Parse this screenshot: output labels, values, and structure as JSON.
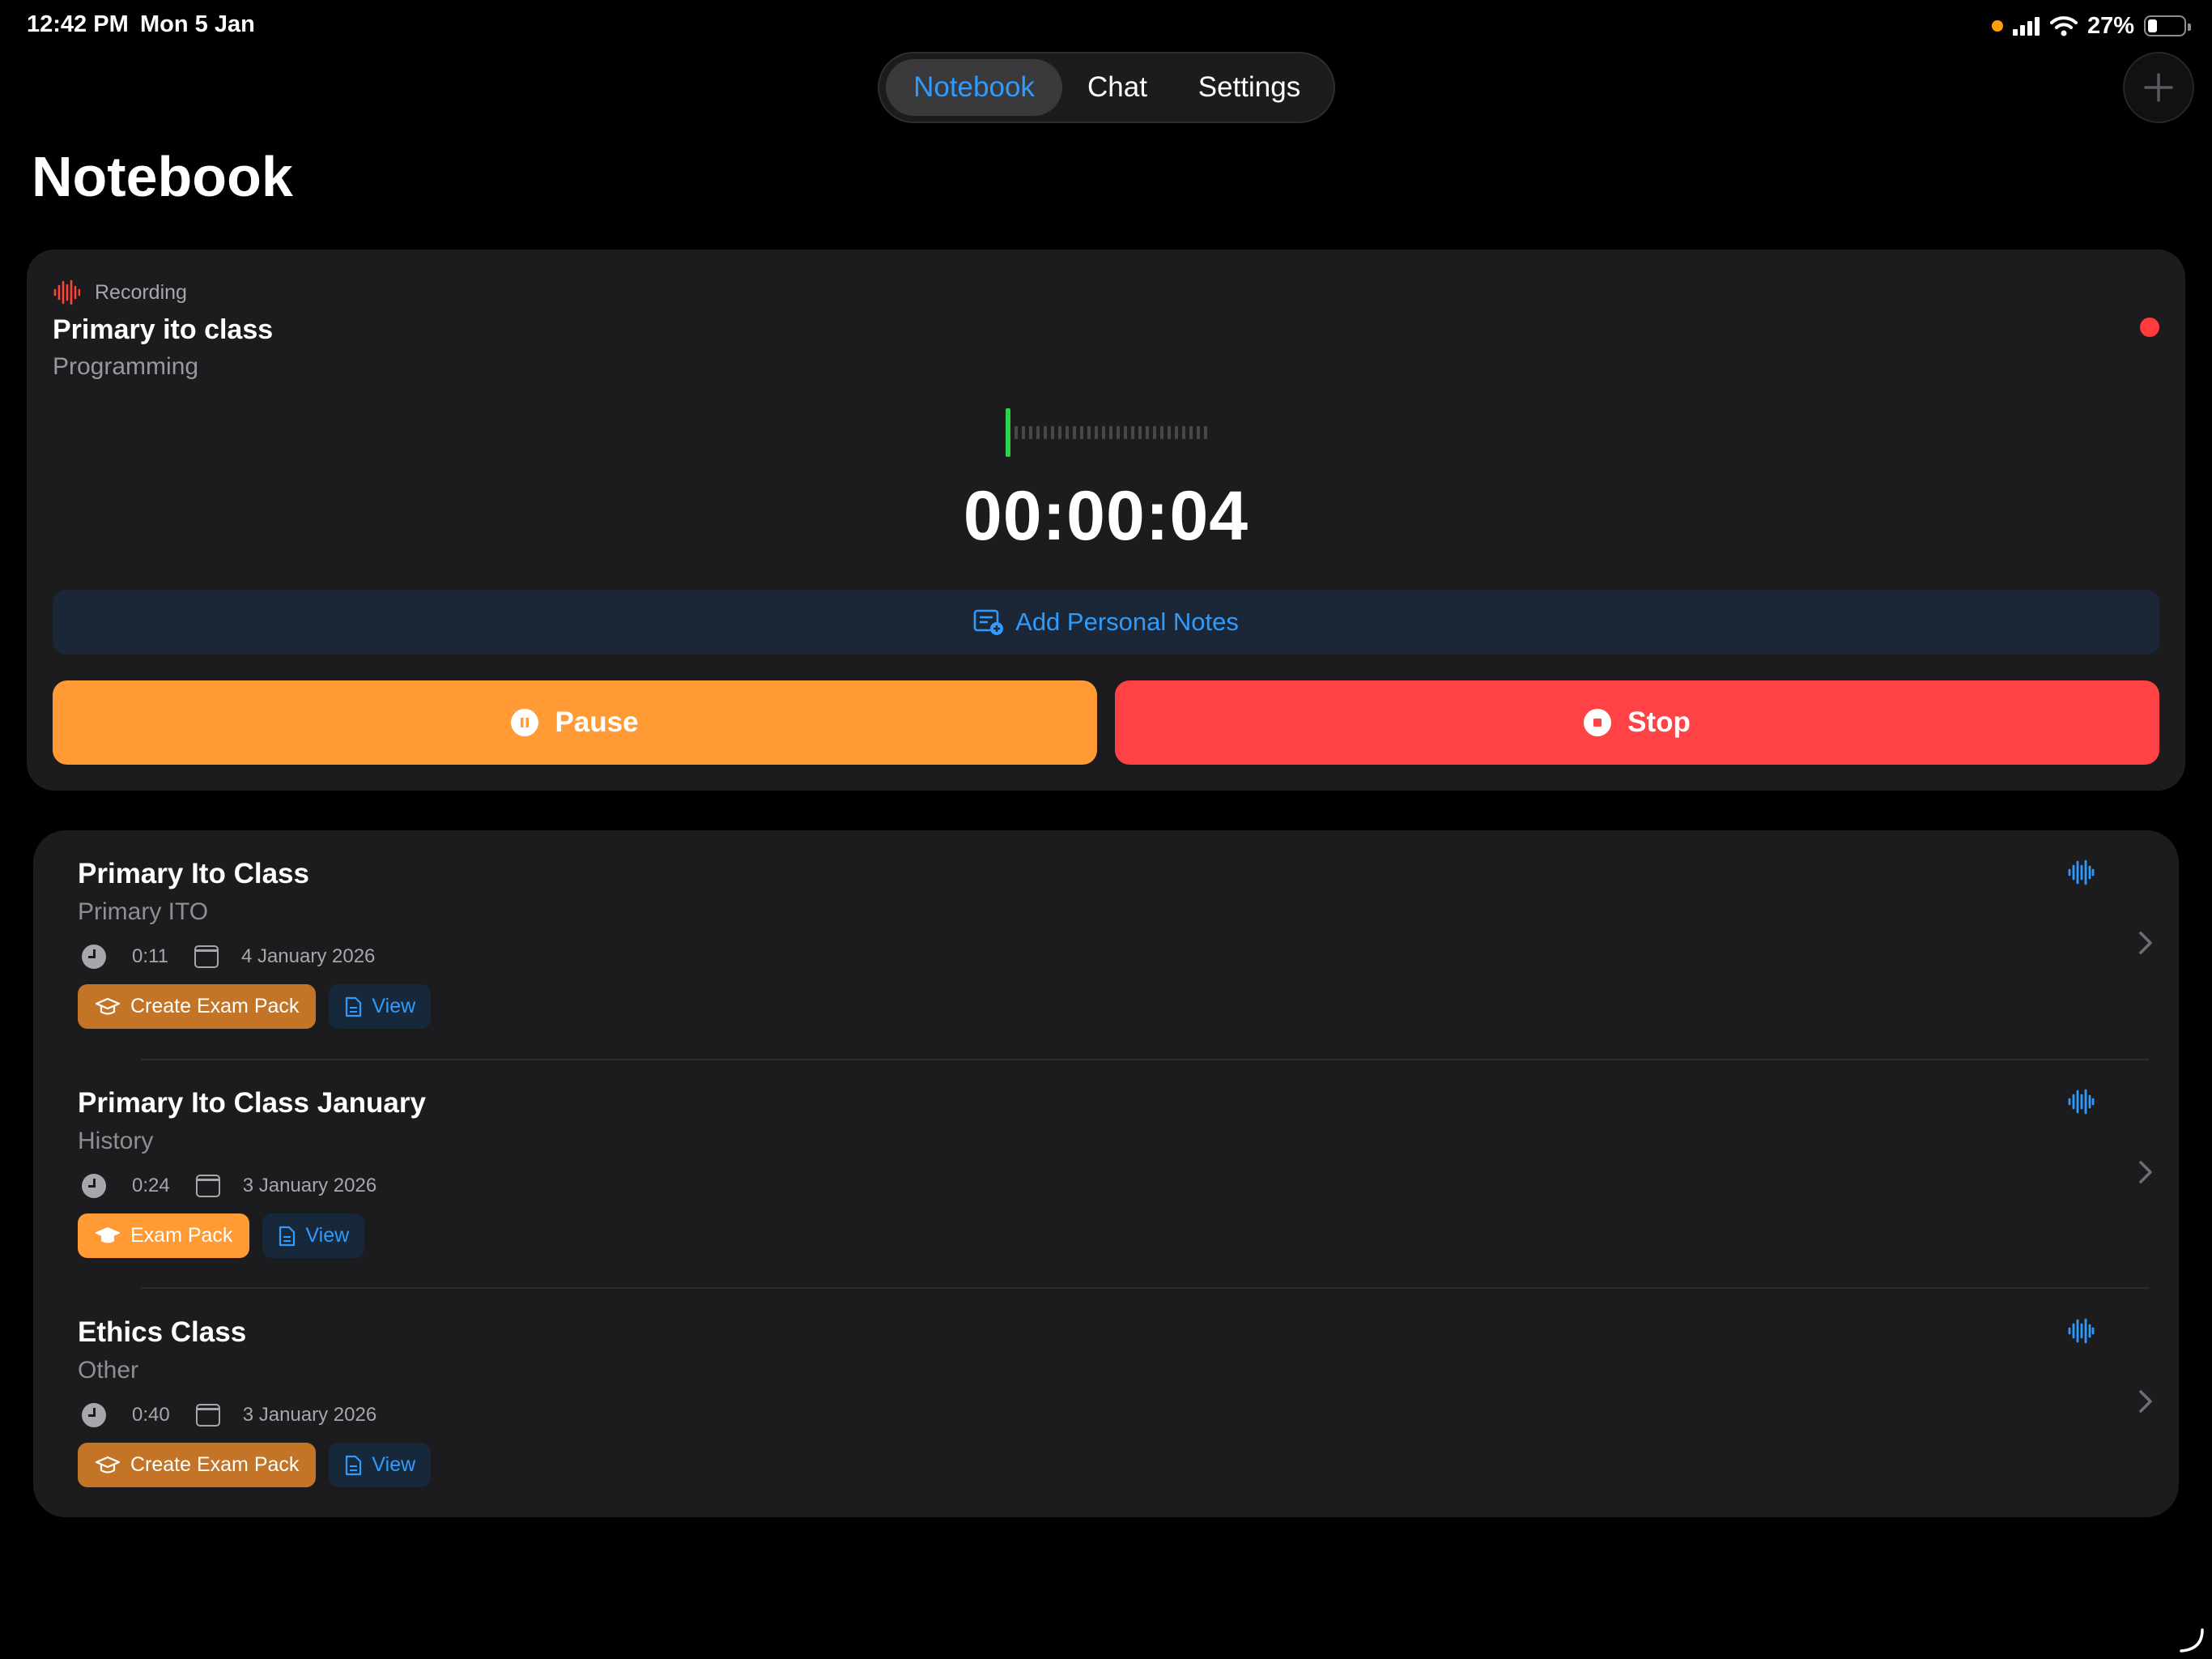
{
  "status_bar": {
    "time": "12:42 PM",
    "date": "Mon 5 Jan",
    "battery": "27%",
    "battery_level": 0.27
  },
  "nav": {
    "tabs": [
      {
        "label": "Notebook",
        "active": true
      },
      {
        "label": "Chat",
        "active": false
      },
      {
        "label": "Settings",
        "active": false
      }
    ],
    "add_icon": "plus-icon"
  },
  "page": {
    "title": "Notebook"
  },
  "recording": {
    "status_label": "Recording",
    "title": "Primary ito class",
    "subject": "Programming",
    "timer": "00:00:04",
    "add_notes_label": "Add Personal Notes",
    "pause_label": "Pause",
    "stop_label": "Stop",
    "colors": {
      "pause": "#ff9a34",
      "stop": "#ff4245",
      "live_dot": "#ff3b3b",
      "meter": "#2bd34b"
    }
  },
  "recordings": [
    {
      "title": "Primary Ito Class",
      "subject": "Primary ITO",
      "duration": "0:11",
      "date": "4 January 2026",
      "exam_label": "Create Exam Pack",
      "view_label": "View"
    },
    {
      "title": "Primary Ito Class January",
      "subject": "History",
      "duration": "0:24",
      "date": "3 January 2026",
      "exam_label": "Exam Pack",
      "view_label": "View"
    },
    {
      "title": "Ethics Class",
      "subject": "Other",
      "duration": "0:40",
      "date": "3 January 2026",
      "exam_label": "Create Exam Pack",
      "view_label": "View"
    }
  ],
  "accent_color": "#2f9bff"
}
